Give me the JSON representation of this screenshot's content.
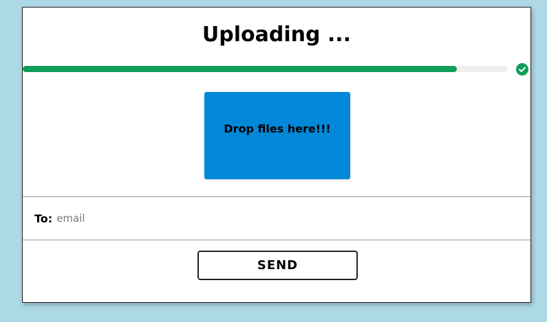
{
  "header": {
    "title": "Uploading ..."
  },
  "progress": {
    "percent": 89.5,
    "fill_color": "#0f9d58",
    "track_color": "#eeeeee",
    "status_icon": "check-circle-icon"
  },
  "dropzone": {
    "label": "Drop files here!!!",
    "color": "#0288d8"
  },
  "recipient": {
    "label": "To:",
    "placeholder": "email",
    "value": ""
  },
  "actions": {
    "send_label": "SEND"
  }
}
